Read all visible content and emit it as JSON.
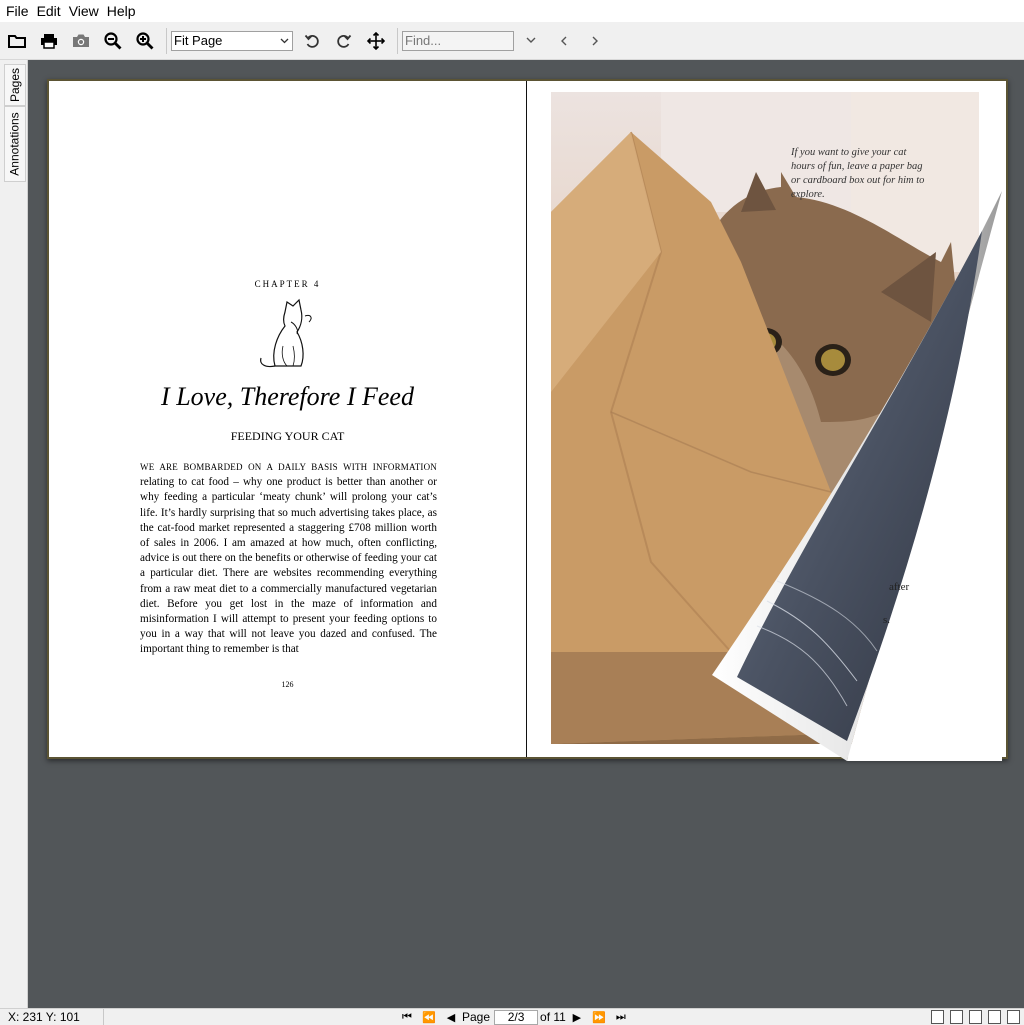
{
  "menubar": {
    "items": [
      "File",
      "Edit",
      "View",
      "Help"
    ]
  },
  "toolbar": {
    "open_icon": "folder-icon",
    "print_icon": "printer-icon",
    "snapshot_icon": "camera-icon",
    "zoom_out_icon": "zoom-out-icon",
    "zoom_in_icon": "zoom-in-icon",
    "zoom_mode": "Fit Page",
    "rotate_left_icon": "rotate-left-icon",
    "rotate_right_icon": "rotate-right-icon",
    "pan_icon": "move-icon",
    "find_placeholder": "Find...",
    "find_next_icon": "chevron-down-icon",
    "find_prev_icon": "chevron-left-icon",
    "find_fwd_icon": "chevron-right-icon"
  },
  "sidebar": {
    "tabs": [
      "Pages",
      "Annotations"
    ]
  },
  "document": {
    "left_page": {
      "chapter_label": "CHAPTER 4",
      "title": "I Love, Therefore I Feed",
      "subtitle": "FEEDING YOUR CAT",
      "lead_smallcaps": "WE ARE BOMBARDED ON A DAILY BASIS WITH INFORMATION",
      "body": "relating to cat food – why one product is better than another or why feeding a particular ‘meaty chunk’ will prolong your cat’s life. It’s hardly surprising that so much advertising takes place, as the cat-food market represented a staggering £708 million worth of sales in 2006. I am amazed at how much, often conflicting, advice is out there on the benefits or otherwise of feeding your cat a particular diet. There are websites recommending everything from a raw meat diet to a commercially manufactured vegetarian diet. Before you get lost in the maze of information and misinformation I will attempt to present your feeding options to you in a way that will not leave you dazed and confused. The important thing to remember is that",
      "page_number": "126"
    },
    "right_page": {
      "caption": "If you want to give your cat hours of fun, leave a paper bag or cardboard box out for him to explore.",
      "peek_text_1": "after",
      "peek_text_2": "s."
    }
  },
  "statusbar": {
    "coords": "X: 231 Y: 101",
    "page_label": "Page",
    "page_value": "2/3",
    "page_total": "of 11"
  }
}
